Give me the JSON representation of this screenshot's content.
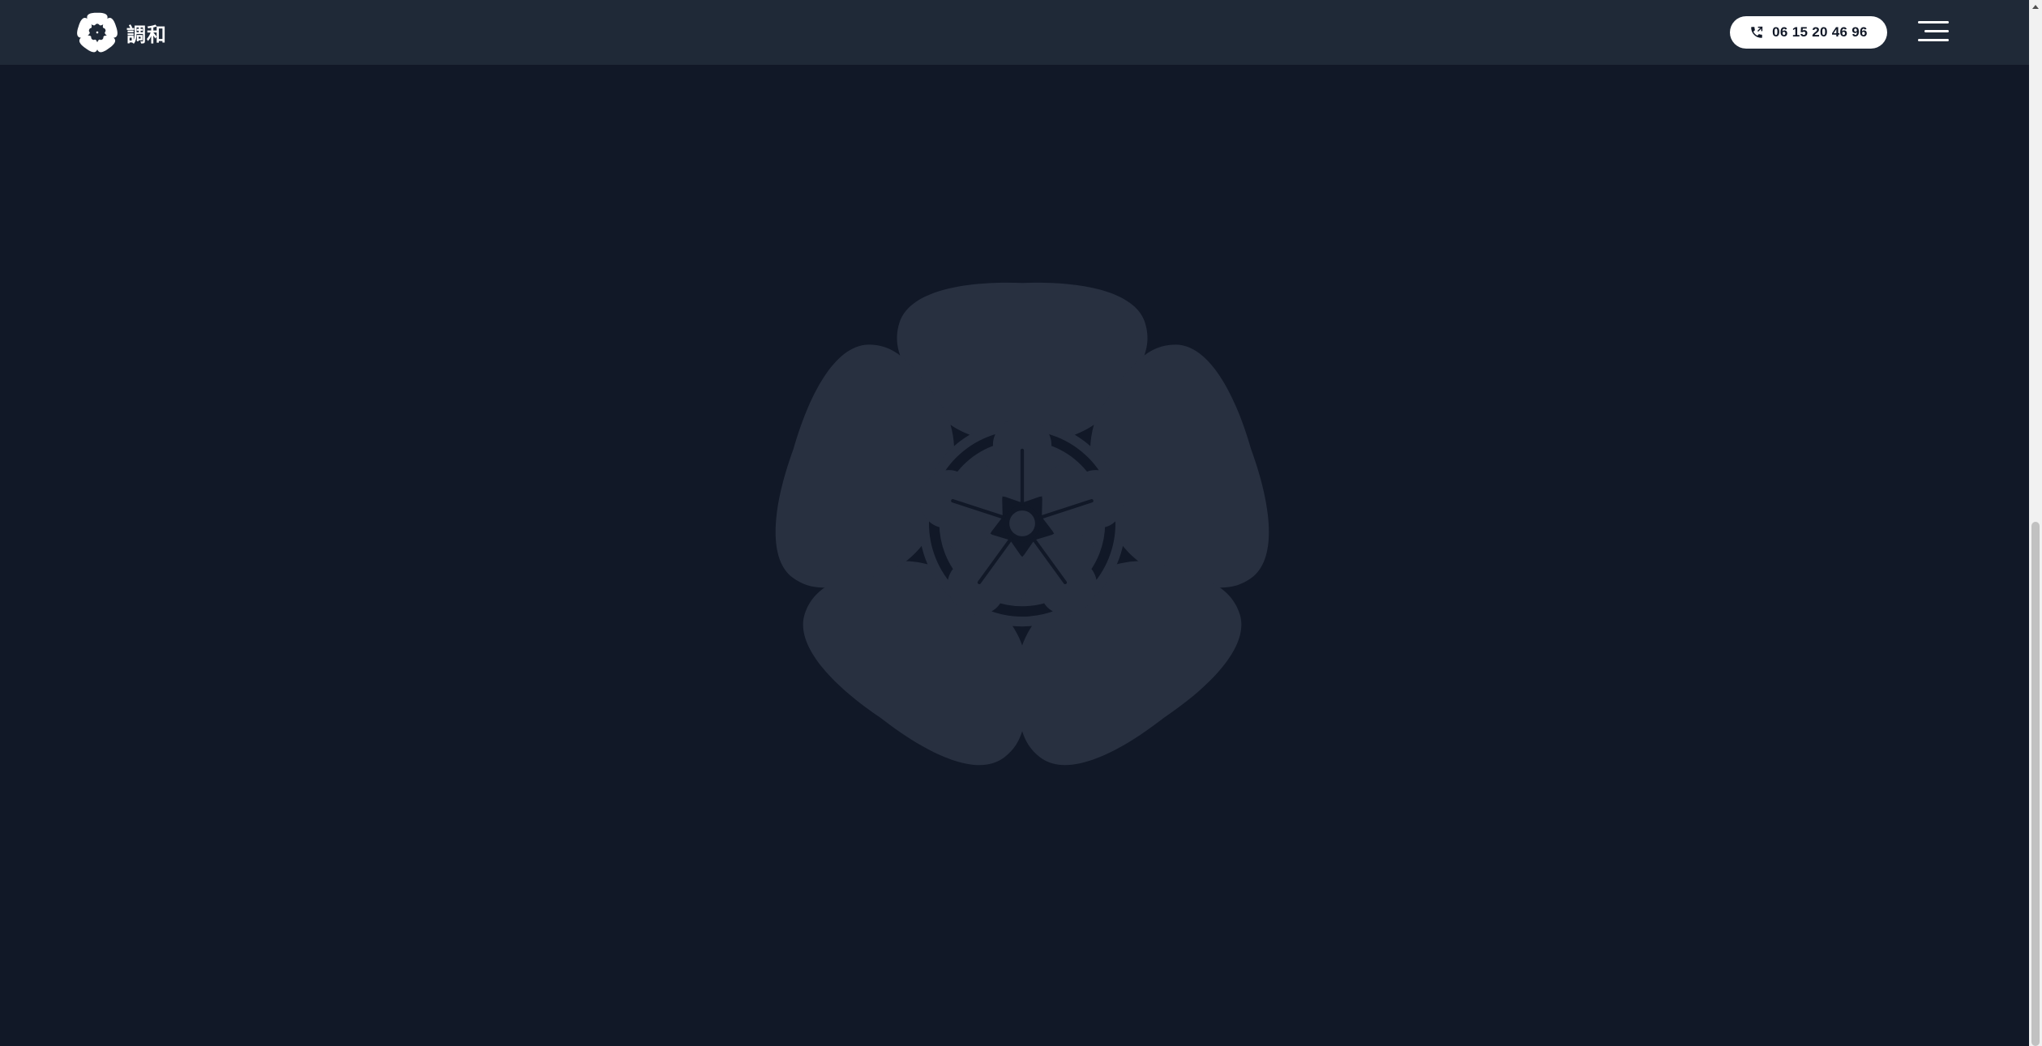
{
  "header": {
    "brand_name": "調和",
    "logo_icon": "flower-crest-icon",
    "phone_icon": "phone-icon",
    "phone_number": "06 15 20 46 96",
    "menu_icon": "hamburger-menu-icon"
  },
  "hero": {
    "emblem_icon": "flower-crest-emblem-icon"
  },
  "colors": {
    "background": "#111827",
    "header_background": "#1f2937",
    "emblem_fill": "#283040",
    "button_background": "#ffffff",
    "text_light": "#ffffff",
    "text_dark": "#111827"
  }
}
